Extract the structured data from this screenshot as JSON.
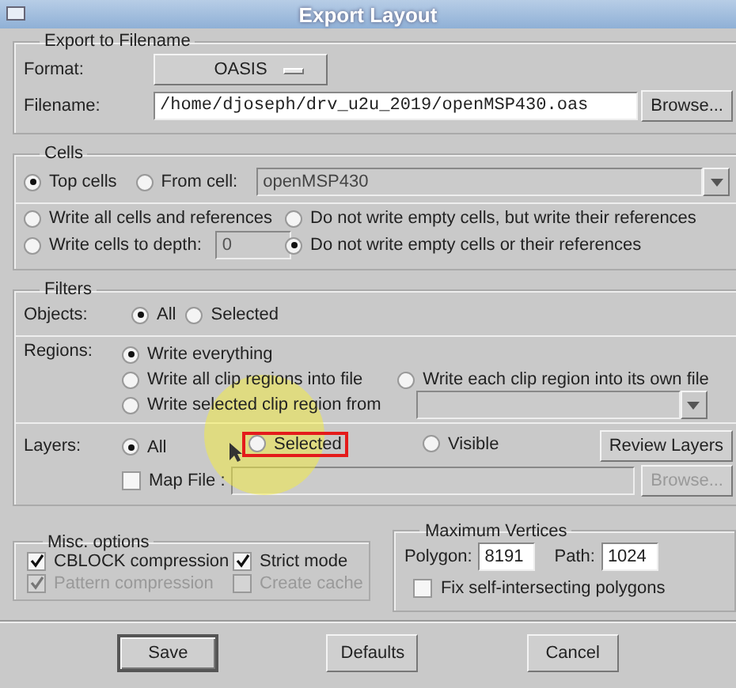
{
  "window": {
    "title": "Export Layout"
  },
  "export_group": {
    "title": "Export to Filename",
    "format": {
      "label": "Format:",
      "value": "OASIS"
    },
    "filename": {
      "label": "Filename:",
      "value": "/home/djoseph/drv_u2u_2019/openMSP430.oas",
      "button": "Browse..."
    }
  },
  "cells": {
    "title": "Cells",
    "source": [
      {
        "label": "Top cells",
        "selected": true
      },
      {
        "label": "From cell:",
        "selected": false
      }
    ],
    "from_cell": {
      "value": "openMSP430",
      "disabled": true
    },
    "options": [
      {
        "label": "Write all cells and references",
        "selected": false
      },
      {
        "label": "Do not write empty cells, but write their references",
        "selected": false
      },
      {
        "label": "Write cells to depth:",
        "selected": false,
        "field": "0"
      },
      {
        "label": "Do not write empty cells or their references",
        "selected": true
      }
    ]
  },
  "filters": {
    "title": "Filters",
    "objects": {
      "label": "Objects:",
      "options": [
        {
          "label": "All",
          "selected": true
        },
        {
          "label": "Selected",
          "selected": false
        }
      ]
    },
    "regions": {
      "label": "Regions:",
      "rows": [
        [
          {
            "label": "Write everything",
            "selected": true
          }
        ],
        [
          {
            "label": "Write all clip regions into file",
            "selected": false
          },
          {
            "label": "Write each clip region into its own file",
            "selected": false
          }
        ],
        [
          {
            "label": "Write selected clip region from",
            "selected": false
          }
        ]
      ],
      "dropdown_disabled": true
    },
    "layers": {
      "label": "Layers:",
      "options": [
        {
          "label": "All",
          "selected": true,
          "highlighted": false
        },
        {
          "label": "Selected",
          "selected": false,
          "highlighted": true
        },
        {
          "label": "Visible",
          "selected": false,
          "highlighted": false
        }
      ],
      "button": "Review Layers"
    },
    "map_file": {
      "label": "Map File :",
      "checked": false,
      "disabled": true,
      "button": "Browse..."
    }
  },
  "misc": {
    "title": "Misc. options",
    "checkboxes": [
      {
        "label": "CBLOCK compression",
        "checked": true,
        "disabled": false
      },
      {
        "label": "Strict mode",
        "checked": true,
        "disabled": false
      },
      {
        "label": "Pattern compression",
        "checked": true,
        "disabled": true
      },
      {
        "label": "Create cache",
        "checked": false,
        "disabled": true
      }
    ]
  },
  "vertices": {
    "title": "Maximum Vertices",
    "polygon": {
      "label": "Polygon:",
      "value": "8191"
    },
    "path": {
      "label": "Path:",
      "value": "1024"
    },
    "fix": {
      "label": "Fix self-intersecting polygons",
      "checked": false
    }
  },
  "buttons": [
    {
      "label": "Save",
      "default": true
    },
    {
      "label": "Defaults",
      "default": false
    },
    {
      "label": "Cancel",
      "default": false
    }
  ]
}
